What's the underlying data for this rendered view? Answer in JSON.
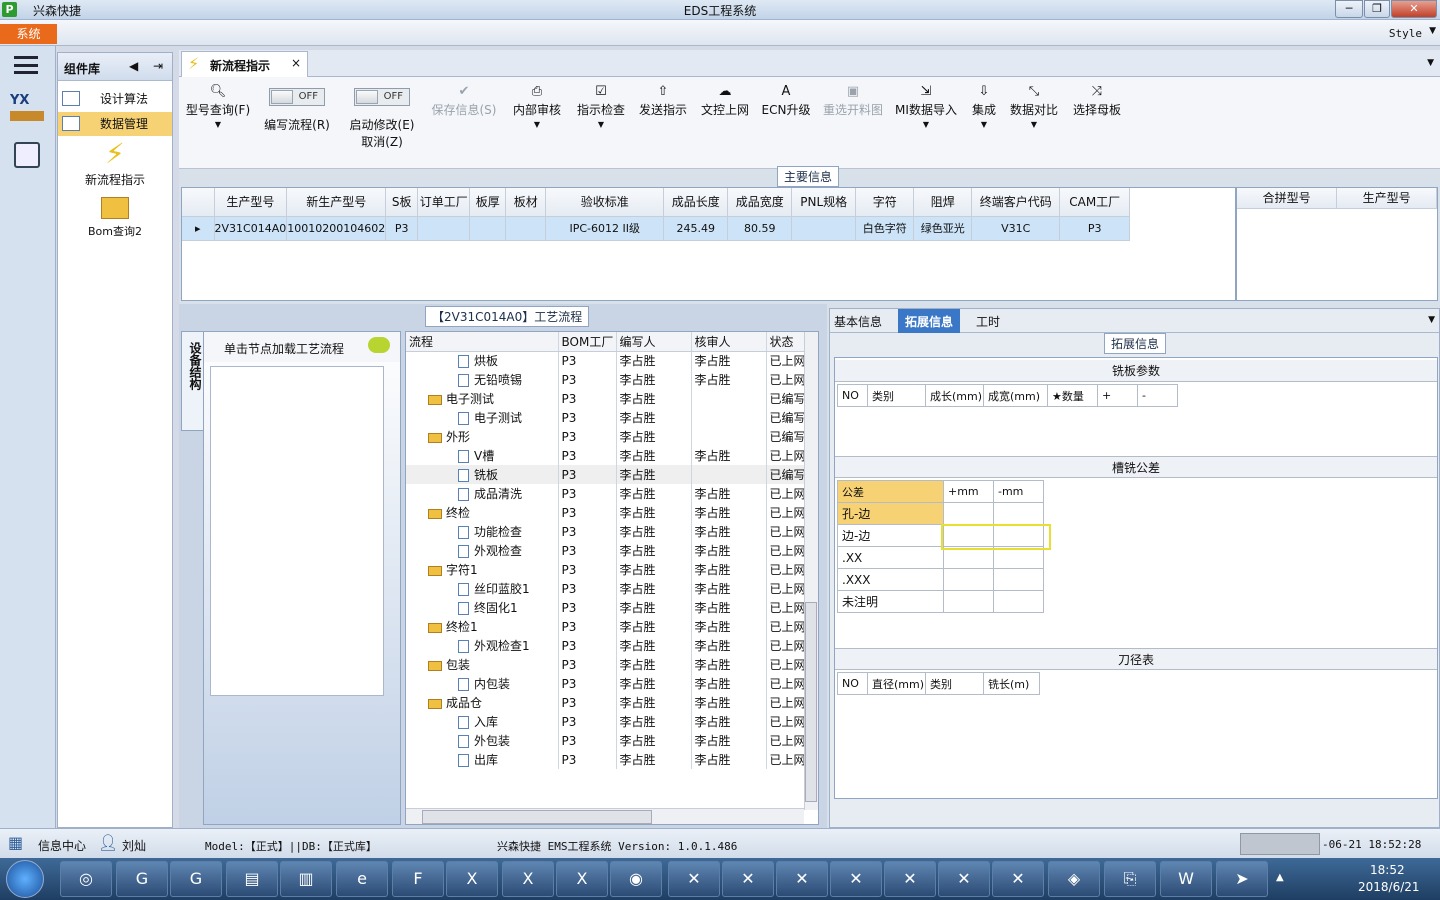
{
  "window": {
    "app_name": "兴森快捷",
    "title": "EDS工程系统",
    "min": "─",
    "max": "❐",
    "close": "✕"
  },
  "menu": {
    "system": "系统",
    "style": "Style"
  },
  "left_icons": [
    "menu-icon",
    "yx-factory-icon",
    "calculator-icon"
  ],
  "components": {
    "title": "组件库",
    "items": [
      {
        "label": "设计算法",
        "selected": false
      },
      {
        "label": "数据管理",
        "selected": true
      }
    ],
    "big": [
      {
        "label": "新流程指示"
      },
      {
        "label": "Bom查询2"
      }
    ]
  },
  "tab": {
    "label": "新流程指示",
    "close": "×"
  },
  "toolbar": {
    "query": "型号查询(F)",
    "write_flow": "编写流程(R)",
    "start_modify": "启动修改(E)",
    "cancel": "取消(Z)",
    "off": "OFF",
    "save": "保存信息(S)",
    "internal": "内部审核",
    "check": "指示检查",
    "send": "发送指示",
    "upload": "文控上网",
    "ecn": "ECN升级",
    "rematerial": "重选开料图",
    "mi_import": "MI数据导入",
    "integrate": "集成",
    "compare": "数据对比",
    "choose": "选择母板"
  },
  "main_info": {
    "label": "主要信息",
    "columns": [
      "生产型号",
      "新生产型号",
      "S板",
      "订单工厂",
      "板厚",
      "板材",
      "验收标准",
      "成品长度",
      "成品宽度",
      "PNL规格",
      "字符",
      "阻焊",
      "终端客户代码",
      "CAM工厂"
    ],
    "rows": [
      [
        "2V31C014A0",
        "10010200104602",
        "P3",
        "",
        "",
        "",
        "IPC-6012 II级",
        "245.49",
        "80.59",
        "",
        "白色字符",
        "绿色亚光",
        "V31C",
        "P3"
      ]
    ],
    "side_columns": [
      "合拼型号",
      "生产型号"
    ]
  },
  "process": {
    "label": "【2V31C014A0】工艺流程",
    "hint": "单击节点加载工艺流程",
    "vtab": "设备结构",
    "columns": [
      "流程",
      "BOM工厂",
      "编写人",
      "核审人",
      "状态"
    ],
    "rows": [
      {
        "name": "烘板",
        "level": 2,
        "factory": "P3",
        "writer": "李占胜",
        "reviewer": "李占胜",
        "status": "已上网"
      },
      {
        "name": "无铅喷锡",
        "level": 2,
        "factory": "P3",
        "writer": "李占胜",
        "reviewer": "李占胜",
        "status": "已上网"
      },
      {
        "name": "电子测试",
        "level": 1,
        "factory": "P3",
        "writer": "李占胜",
        "reviewer": "",
        "status": "已编写"
      },
      {
        "name": "电子测试",
        "level": 2,
        "factory": "P3",
        "writer": "李占胜",
        "reviewer": "",
        "status": "已编写"
      },
      {
        "name": "外形",
        "level": 1,
        "factory": "P3",
        "writer": "李占胜",
        "reviewer": "",
        "status": "已编写"
      },
      {
        "name": "V槽",
        "level": 2,
        "factory": "P3",
        "writer": "李占胜",
        "reviewer": "李占胜",
        "status": "已上网"
      },
      {
        "name": "铣板",
        "level": 2,
        "factory": "P3",
        "writer": "李占胜",
        "reviewer": "",
        "status": "已编写",
        "hl": true
      },
      {
        "name": "成品清洗",
        "level": 2,
        "factory": "P3",
        "writer": "李占胜",
        "reviewer": "李占胜",
        "status": "已上网"
      },
      {
        "name": "终检",
        "level": 1,
        "factory": "P3",
        "writer": "李占胜",
        "reviewer": "李占胜",
        "status": "已上网"
      },
      {
        "name": "功能检查",
        "level": 2,
        "factory": "P3",
        "writer": "李占胜",
        "reviewer": "李占胜",
        "status": "已上网"
      },
      {
        "name": "外观检查",
        "level": 2,
        "factory": "P3",
        "writer": "李占胜",
        "reviewer": "李占胜",
        "status": "已上网"
      },
      {
        "name": "字符1",
        "level": 1,
        "factory": "P3",
        "writer": "李占胜",
        "reviewer": "李占胜",
        "status": "已上网"
      },
      {
        "name": "丝印蓝胶1",
        "level": 2,
        "factory": "P3",
        "writer": "李占胜",
        "reviewer": "李占胜",
        "status": "已上网"
      },
      {
        "name": "终固化1",
        "level": 2,
        "factory": "P3",
        "writer": "李占胜",
        "reviewer": "李占胜",
        "status": "已上网"
      },
      {
        "name": "终检1",
        "level": 1,
        "factory": "P3",
        "writer": "李占胜",
        "reviewer": "李占胜",
        "status": "已上网"
      },
      {
        "name": "外观检查1",
        "level": 2,
        "factory": "P3",
        "writer": "李占胜",
        "reviewer": "李占胜",
        "status": "已上网"
      },
      {
        "name": "包装",
        "level": 1,
        "factory": "P3",
        "writer": "李占胜",
        "reviewer": "李占胜",
        "status": "已上网"
      },
      {
        "name": "内包装",
        "level": 2,
        "factory": "P3",
        "writer": "李占胜",
        "reviewer": "李占胜",
        "status": "已上网"
      },
      {
        "name": "成品仓",
        "level": 1,
        "factory": "P3",
        "writer": "李占胜",
        "reviewer": "李占胜",
        "status": "已上网"
      },
      {
        "name": "入库",
        "level": 2,
        "factory": "P3",
        "writer": "李占胜",
        "reviewer": "李占胜",
        "status": "已上网"
      },
      {
        "name": "外包装",
        "level": 2,
        "factory": "P3",
        "writer": "李占胜",
        "reviewer": "李占胜",
        "status": "已上网"
      },
      {
        "name": "出库",
        "level": 2,
        "factory": "P3",
        "writer": "李占胜",
        "reviewer": "李占胜",
        "status": "已上网"
      }
    ]
  },
  "right_tabs": [
    "基本信息",
    "拓展信息",
    "工时"
  ],
  "ext": {
    "label": "拓展信息",
    "mill_title": "铣板参数",
    "mill_cols": [
      "NO",
      "类别",
      "成长(mm)",
      "成宽(mm)",
      "★数量",
      "+",
      "-"
    ],
    "slot_title": "槽铣公差",
    "slot_cols": [
      "公差",
      "+mm",
      "-mm"
    ],
    "slot_rows": [
      "孔-边",
      "边-边",
      ".XX",
      ".XXX",
      "未注明"
    ],
    "tool_title": "刀径表",
    "tool_cols": [
      "NO",
      "直径(mm)",
      "类别",
      "铣长(m)"
    ]
  },
  "status": {
    "info_center": "信息中心",
    "user": "刘灿",
    "model": "Model:【正式】||DB:【正式库】",
    "system": "兴森快捷 EMS工程系统 Version: 1.0.1.486",
    "datetime": "-06-21 18:52:28"
  },
  "taskbar": {
    "time": "18:52",
    "date": "2018/6/21"
  }
}
